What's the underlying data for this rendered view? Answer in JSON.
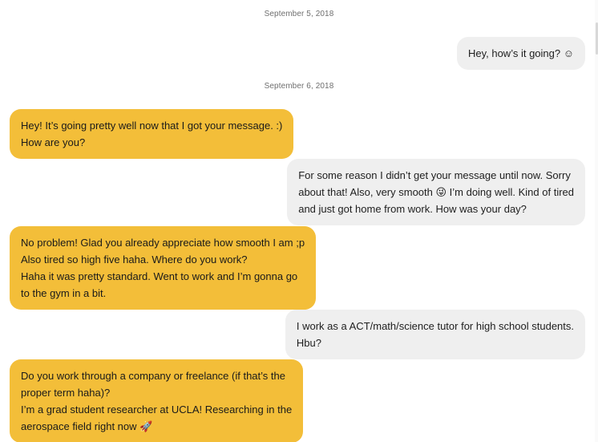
{
  "dates": [
    "September 5, 2018",
    "September 6, 2018"
  ],
  "messages": [
    {
      "direction": "outgoing",
      "text": "Hey, how’s it going? ☺"
    },
    {
      "direction": "incoming",
      "text": "Hey! It’s going pretty well now that I got your message. :)\nHow are you?"
    },
    {
      "direction": "outgoing",
      "text": "For some reason I didn’t get your message until now. Sorry\nabout that! Also, very smooth 😜 I’m doing well. Kind of tired\nand just got home from work. How was your day?"
    },
    {
      "direction": "incoming",
      "text": "No problem! Glad you already appreciate how smooth I am ;p\nAlso tired so high five haha. Where do you work?\nHaha it was pretty standard. Went to work and I’m gonna go\nto the gym in a bit."
    },
    {
      "direction": "outgoing",
      "text": "I work as a ACT/math/science tutor for high school students.\nHbu?"
    },
    {
      "direction": "incoming",
      "text": "Do you work through a company or freelance (if that’s the\nproper term haha)?\nI’m a grad student researcher at UCLA! Researching in the\naerospace field right now 🚀"
    }
  ],
  "colors": {
    "incoming_bubble": "#f3be39",
    "outgoing_bubble": "#efefef",
    "date_text": "#6f6f6f"
  }
}
